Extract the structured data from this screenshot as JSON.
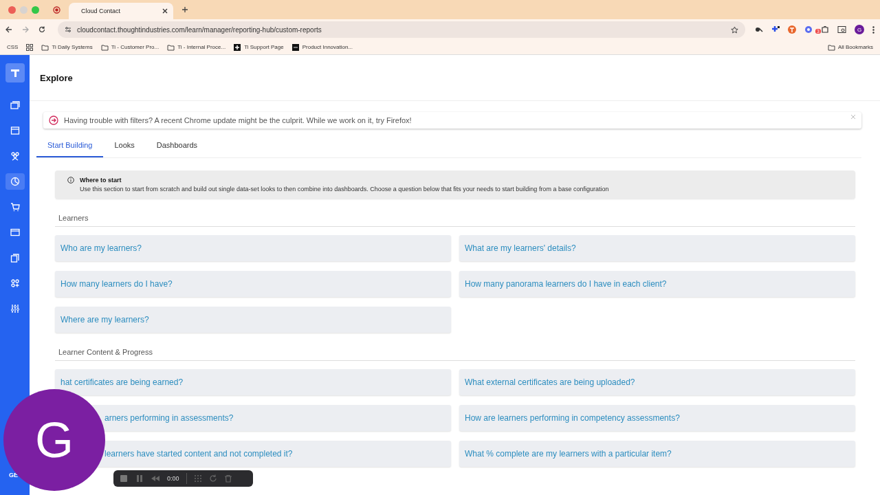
{
  "browser": {
    "tab_title": "Cloud Contact",
    "url": "cloudcontact.thoughtindustries.com/learn/manager/reporting-hub/custom-reports",
    "bookmarks": [
      {
        "label": "CSS",
        "kind": "plain"
      },
      {
        "label": "Ti Daily Systems",
        "kind": "folder"
      },
      {
        "label": "Ti - Customer Pro...",
        "kind": "folder"
      },
      {
        "label": "Ti - Internal Proce...",
        "kind": "folder"
      },
      {
        "label": "Ti Support Page",
        "kind": "plus"
      },
      {
        "label": "Product Innovation...",
        "kind": "dots"
      }
    ],
    "all_bookmarks": "All Bookmarks",
    "extension_badge": "3",
    "profile_letter": "G"
  },
  "sidebar": {
    "items": [
      {
        "selected": false
      },
      {
        "selected": false
      },
      {
        "selected": false
      },
      {
        "selected": true
      },
      {
        "selected": false
      },
      {
        "selected": false
      },
      {
        "selected": false
      },
      {
        "selected": false
      },
      {
        "selected": false
      }
    ],
    "footer": "GE"
  },
  "page": {
    "title": "Explore",
    "banner": "Having trouble with filters? A recent Chrome update might be the culprit. While we work on it, try Firefox!",
    "tabs": [
      {
        "label": "Start Building",
        "selected": true
      },
      {
        "label": "Looks",
        "selected": false
      },
      {
        "label": "Dashboards",
        "selected": false
      }
    ],
    "info": {
      "title": "Where to start",
      "text": "Use this section to start from scratch and build out single data-set looks to then combine into dashboards. Choose a question below that fits your needs to start building from a base configuration"
    },
    "sections": [
      {
        "title": "Learners",
        "questions": [
          {
            "text": "Who are my learners?",
            "kind": "full"
          },
          {
            "text": "What are my learners' details?",
            "kind": "full"
          },
          {
            "text": "How many learners do I have?",
            "kind": "full"
          },
          {
            "text": "How many panorama learners do I have in each client?",
            "kind": "full"
          },
          {
            "text": "Where are my learners?",
            "kind": "full"
          }
        ]
      },
      {
        "title": "Learner Content & Progress",
        "questions": [
          {
            "text": "hat certificates are being earned?",
            "kind": "full"
          },
          {
            "text": "What external certificates are being uploaded?",
            "kind": "full"
          },
          {
            "text": "arners performing in assessments?",
            "kind": "partial"
          },
          {
            "text": "How are learners performing in competency assessments?",
            "kind": "full"
          },
          {
            "text": "learners have started content and not completed it?",
            "kind": "partial"
          },
          {
            "text": "What % complete are my learners with a particular item?",
            "kind": "full"
          }
        ]
      }
    ]
  },
  "overlay": {
    "avatar_letter": "G",
    "recorder_time": "0:00"
  }
}
